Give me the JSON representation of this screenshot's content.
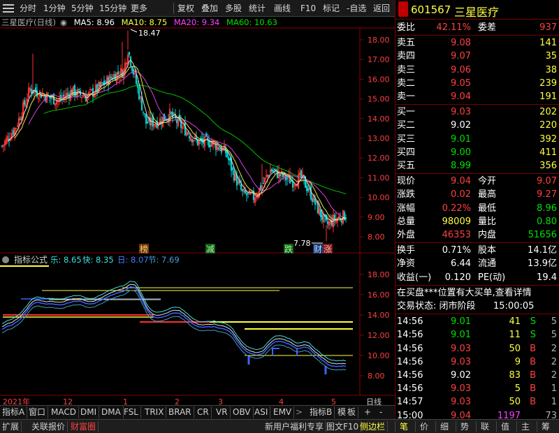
{
  "toolbar": {
    "items": [
      "分时",
      "1分钟",
      "5分钟",
      "15分钟",
      "更多",
      "复权",
      "叠加",
      "多股",
      "统计",
      "画线",
      "F10",
      "标记",
      "-自选",
      "返回"
    ]
  },
  "main_chart": {
    "title": "三星医疗(日线)",
    "ma5": "MA5: 8.96",
    "ma10": "MA10: 8.75",
    "ma20": "MA20: 9.34",
    "ma60": "MA60: 10.63",
    "high_label": "18.47",
    "low_label": "7.78",
    "y_ticks": [
      "18.00",
      "17.00",
      "16.00",
      "15.00",
      "14.00",
      "13.00",
      "12.00",
      "11.00",
      "10.00",
      "9.00",
      "8.00"
    ],
    "markers": [
      "榜",
      "减",
      "跌",
      "财",
      "涨"
    ]
  },
  "indicator": {
    "name": "指标公式",
    "le": "乐: 8.65",
    "kuai": "快: 8.35",
    "ri": "日: 8.07",
    "jie": "节: 7.69",
    "y_ticks": [
      "18.00",
      "16.00",
      "14.00",
      "12.00",
      "10.00",
      "8.00"
    ]
  },
  "date_axis": {
    "labels": [
      "2021年",
      "12",
      "1",
      "2",
      "3",
      "4",
      "5"
    ],
    "period": "日线"
  },
  "bottom_tabs": [
    "指标A",
    "窗口",
    "MACD",
    "DMI",
    "DMA",
    "FSL",
    "TRIX",
    "BRAR",
    "CR",
    "VR",
    "OBV",
    "ASI",
    "EMV",
    "指标B",
    "模",
    "板",
    "+",
    "-"
  ],
  "statusbar": {
    "left": [
      "扩展",
      "关联报价",
      "财富圈"
    ],
    "center": [
      "新用户福利专享",
      "图文F10",
      "侧边栏"
    ],
    "right_icons": [
      "笔",
      "价",
      "细",
      "势",
      "联",
      "值",
      "主",
      "筹"
    ]
  },
  "quote": {
    "code": "601567",
    "name": "三星医疗",
    "weibi_label": "委比",
    "weibi": "42.11%",
    "weicha_label": "委差",
    "weicha": "937",
    "sell": [
      {
        "label": "卖五",
        "price": "9.08",
        "vol": "141"
      },
      {
        "label": "卖四",
        "price": "9.07",
        "vol": "35"
      },
      {
        "label": "卖三",
        "price": "9.06",
        "vol": "38"
      },
      {
        "label": "卖二",
        "price": "9.05",
        "vol": "239"
      },
      {
        "label": "卖一",
        "price": "9.04",
        "vol": "191"
      }
    ],
    "buy": [
      {
        "label": "买一",
        "price": "9.03",
        "vol": "202"
      },
      {
        "label": "买二",
        "price": "9.02",
        "vol": "220"
      },
      {
        "label": "买三",
        "price": "9.01",
        "vol": "392"
      },
      {
        "label": "买四",
        "price": "9.00",
        "vol": "411"
      },
      {
        "label": "买五",
        "price": "8.99",
        "vol": "356"
      }
    ],
    "stats1": [
      {
        "l1": "现价",
        "v1": "9.04",
        "l2": "今开",
        "v2": "9.07"
      },
      {
        "l1": "涨跌",
        "v1": "0.02",
        "l2": "最高",
        "v2": "9.27"
      },
      {
        "l1": "涨幅",
        "v1": "0.22%",
        "l2": "最低",
        "v2": "8.96"
      },
      {
        "l1": "总量",
        "v1": "98009",
        "l2": "量比",
        "v2": "0.80"
      },
      {
        "l1": "外盘",
        "v1": "46353",
        "l2": "内盘",
        "v2": "51656"
      }
    ],
    "stats2": [
      {
        "l1": "换手",
        "v1": "0.71%",
        "l2": "股本",
        "v2": "14.1亿"
      },
      {
        "l1": "净资",
        "v1": "6.44",
        "l2": "流通",
        "v2": "13.9亿"
      },
      {
        "l1": "收益(一)",
        "v1": "0.120",
        "l2": "PE(动)",
        "v2": "19.4"
      }
    ],
    "notice": "在买盘***位置有大买单,查看详情",
    "status": "交易状态: 闭市阶段",
    "status_time": "15:00:05",
    "ticks": [
      {
        "t": "14:56",
        "p": "9.01",
        "v": "41",
        "d": "S",
        "n": "5"
      },
      {
        "t": "14:56",
        "p": "9.01",
        "v": "11",
        "d": "S",
        "n": "5"
      },
      {
        "t": "14:56",
        "p": "9.03",
        "v": "50",
        "d": "B",
        "n": "2"
      },
      {
        "t": "14:56",
        "p": "9.03",
        "v": "9",
        "d": "B",
        "n": "2"
      },
      {
        "t": "14:56",
        "p": "9.02",
        "v": "83",
        "d": "B",
        "n": "2"
      },
      {
        "t": "14:56",
        "p": "9.03",
        "v": "5",
        "d": "B",
        "n": "1"
      },
      {
        "t": "14:57",
        "p": "9.03",
        "v": "50",
        "d": "B",
        "n": "1"
      },
      {
        "t": "15:00",
        "p": "9.04",
        "v": "1197",
        "d": "",
        "n": "73"
      }
    ]
  }
}
